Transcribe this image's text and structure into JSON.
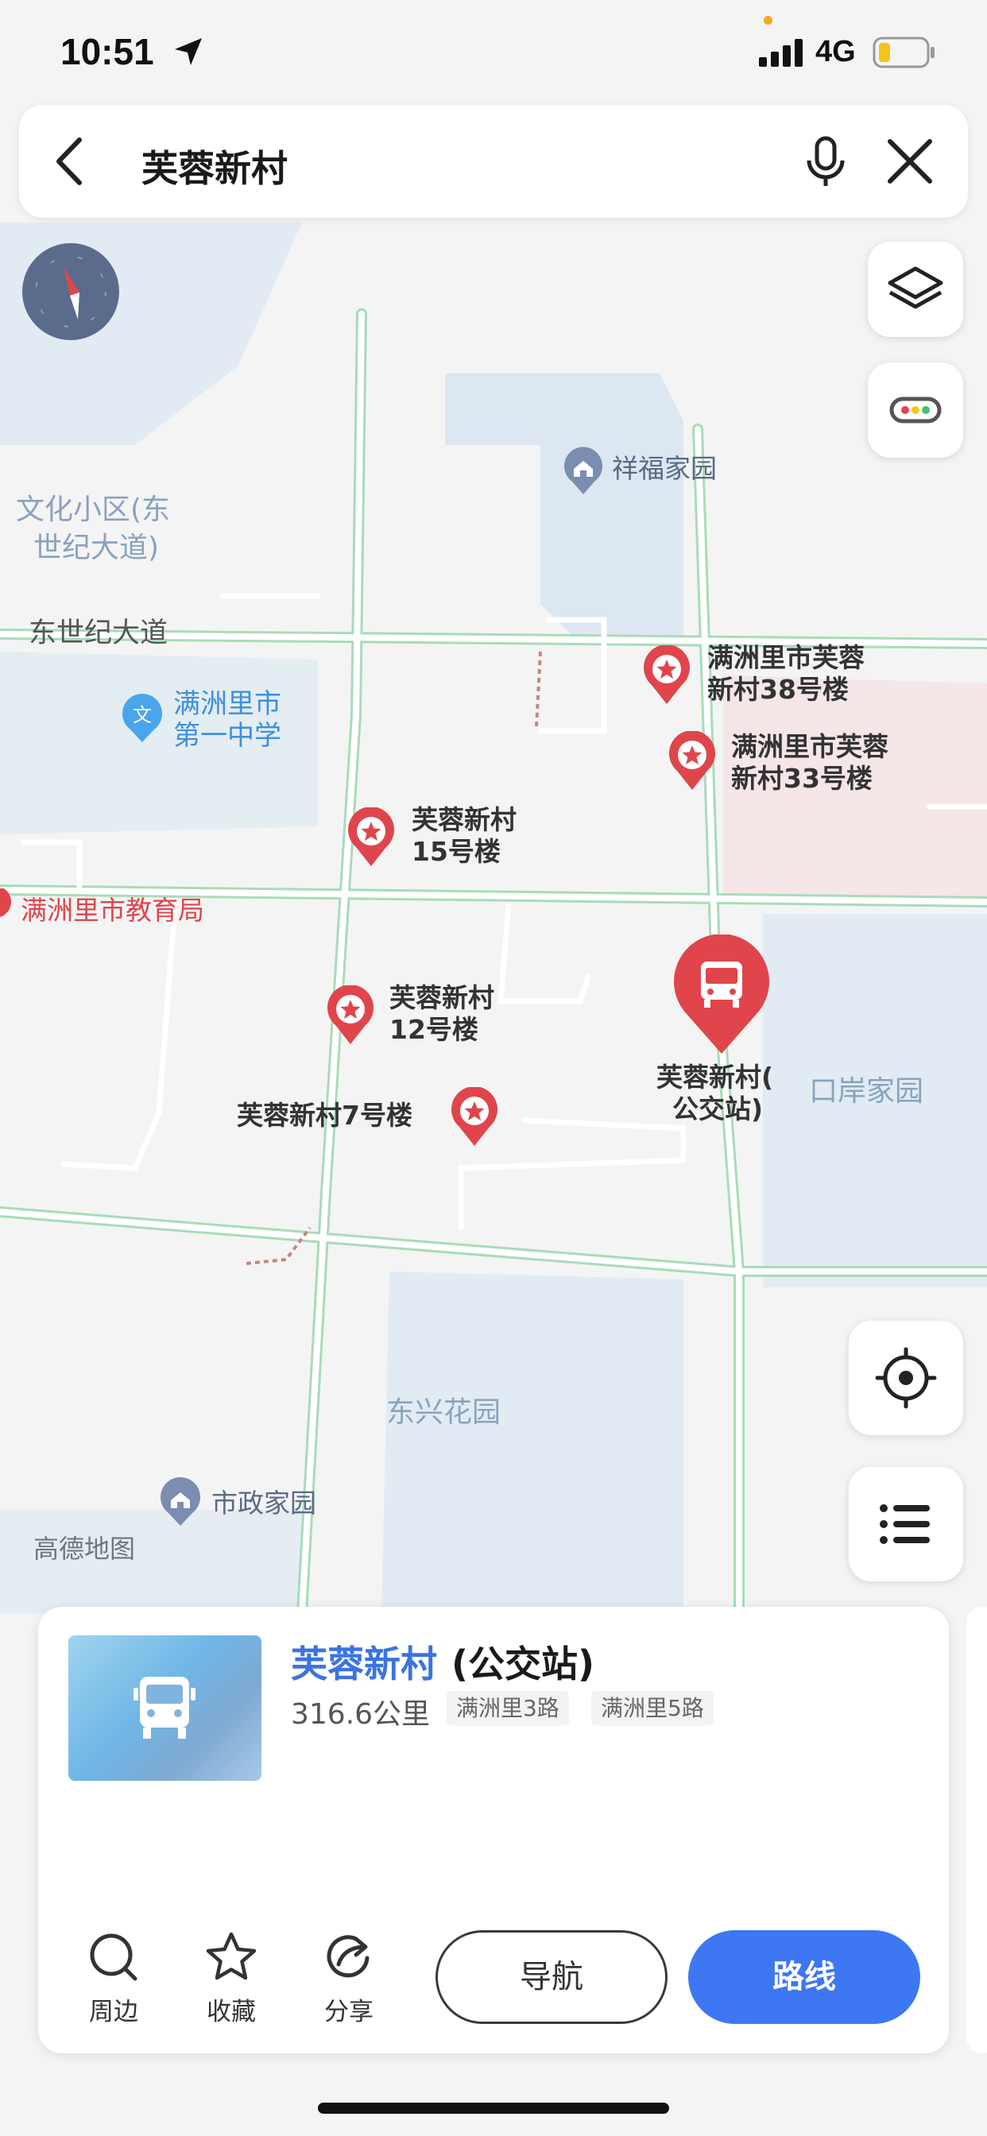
{
  "status_bar": {
    "time": "10:51",
    "network": "4G"
  },
  "search": {
    "query": "芙蓉新村"
  },
  "map": {
    "districts": [
      "文化小区(东",
      "世纪大道)",
      "口岸家园",
      "东兴花园"
    ],
    "roads": [
      "东世纪大道"
    ],
    "pois": {
      "xiangfu": "祥福家园",
      "school_line1": "满洲里市",
      "school_line2": "第一中学",
      "edu_bureau": "满洲里市教育局",
      "shizheng": "市政家园"
    },
    "markers": [
      {
        "line1": "满洲里市芙蓉",
        "line2": "新村38号楼"
      },
      {
        "line1": "满洲里市芙蓉",
        "line2": "新村33号楼"
      },
      {
        "line1": "芙蓉新村",
        "line2": "15号楼"
      },
      {
        "line1": "芙蓉新村",
        "line2": "12号楼"
      },
      {
        "line1": "芙蓉新村7号楼"
      }
    ],
    "selected": {
      "line1": "芙蓉新村(",
      "line2": "公交站)"
    },
    "watermark": "高德地图"
  },
  "card": {
    "title_highlight": "芙蓉新村",
    "title_rest": "(公交站)",
    "distance": "316.6公里",
    "tags": [
      "满洲里3路",
      "满洲里5路"
    ],
    "actions": {
      "nearby": "周边",
      "favorite": "收藏",
      "share": "分享"
    },
    "navigate": "导航",
    "route": "路线"
  },
  "colors": {
    "accent": "#3d77f2",
    "marker_red": "#e0454c",
    "road_green": "#a8dcb8"
  }
}
